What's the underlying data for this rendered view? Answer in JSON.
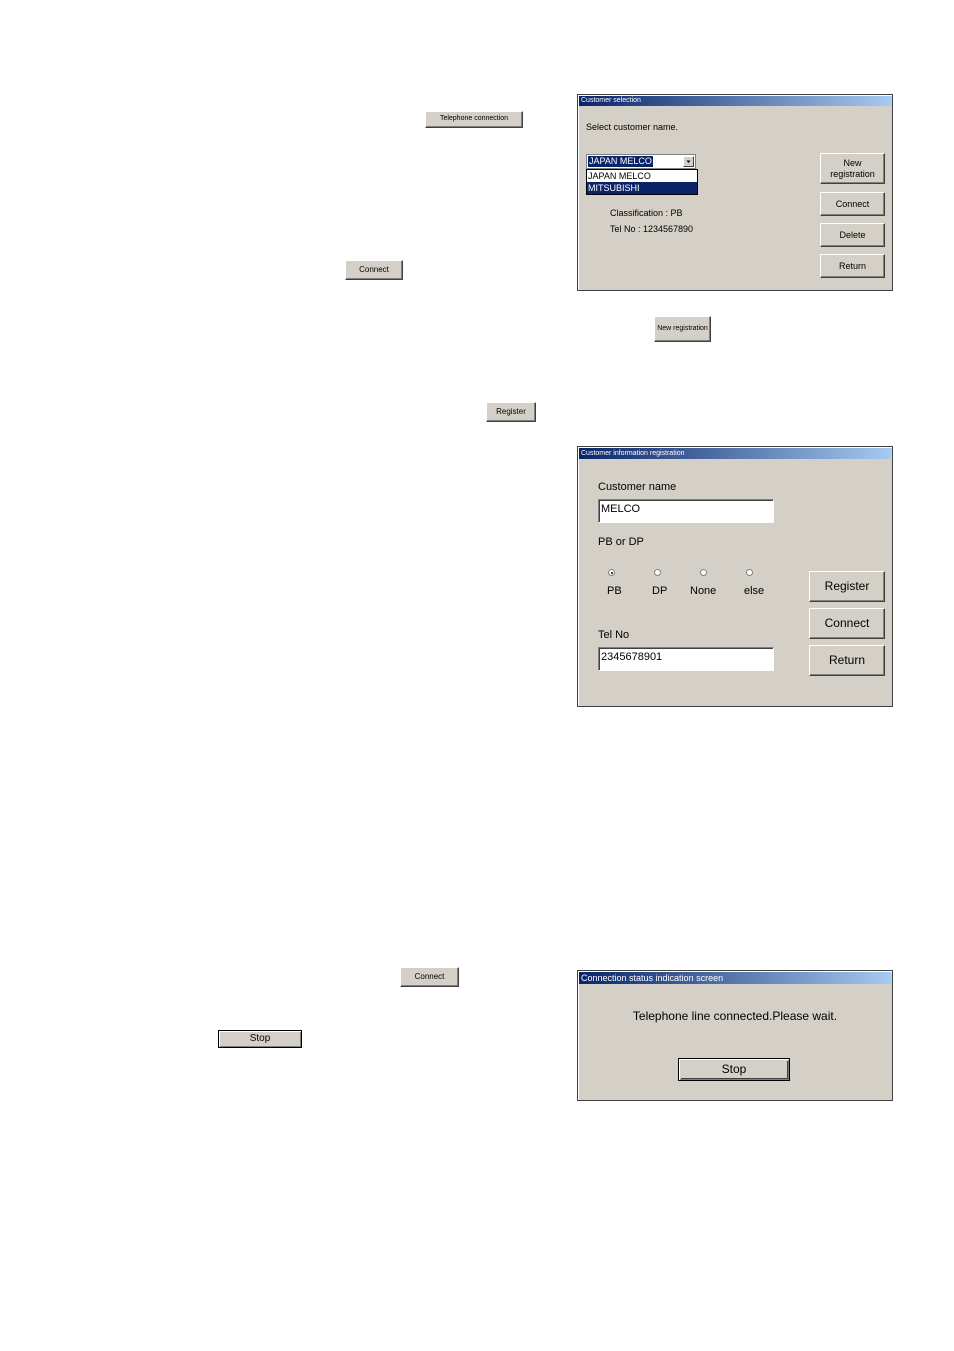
{
  "inline_buttons": {
    "telephone_connection": "Telephone connection",
    "connect_1": "Connect",
    "new_registration": "New registration",
    "register": "Register",
    "connect_2": "Connect",
    "stop": "Stop"
  },
  "customer_selection": {
    "title": "Customer selection",
    "prompt": "Select customer name.",
    "selected_customer": "JAPAN MELCO",
    "options": [
      "JAPAN MELCO",
      "MITSUBISHI"
    ],
    "classification": "Classification : PB",
    "tel_no": "Tel No : 1234567890",
    "buttons": {
      "new_registration": "New registration",
      "connect": "Connect",
      "delete": "Delete",
      "return": "Return"
    }
  },
  "customer_registration": {
    "title": "Customer information registration",
    "customer_name_label": "Customer name",
    "customer_name_value": "MELCO",
    "pb_dp_label": "PB or DP",
    "radios": [
      "PB",
      "DP",
      "None",
      "else"
    ],
    "selected_radio": "PB",
    "tel_no_label": "Tel No",
    "tel_no_value": "2345678901",
    "buttons": {
      "register": "Register",
      "connect": "Connect",
      "return": "Return"
    }
  },
  "connection_status": {
    "title": "Connection status indication screen",
    "message": "Telephone line connected.Please wait.",
    "stop_button": "Stop"
  }
}
